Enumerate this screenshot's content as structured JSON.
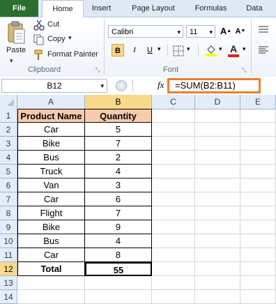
{
  "tabs": [
    "File",
    "Home",
    "Insert",
    "Page Layout",
    "Formulas",
    "Data"
  ],
  "clipboard": {
    "paste": "Paste",
    "cut": "Cut",
    "copy": "Copy",
    "format_painter": "Format Painter",
    "group_label": "Clipboard"
  },
  "font": {
    "name": "Calibri",
    "size": "11",
    "group_label": "Font",
    "bold": "B",
    "italic": "I",
    "underline": "U"
  },
  "formula_bar": {
    "name_box": "B12",
    "fx": "fx",
    "formula": "=SUM(B2:B11)"
  },
  "columns": [
    "A",
    "B",
    "C",
    "D",
    "E"
  ],
  "rows": [
    "1",
    "2",
    "3",
    "4",
    "5",
    "6",
    "7",
    "8",
    "9",
    "10",
    "11",
    "12",
    "13",
    "14"
  ],
  "table": {
    "headers": [
      "Product Name",
      "Quantity"
    ],
    "data": [
      [
        "Car",
        "5"
      ],
      [
        "Bike",
        "7"
      ],
      [
        "Bus",
        "2"
      ],
      [
        "Truck",
        "4"
      ],
      [
        "Van",
        "3"
      ],
      [
        "Car",
        "6"
      ],
      [
        "Flight",
        "7"
      ],
      [
        "Bike",
        "9"
      ],
      [
        "Bus",
        "4"
      ],
      [
        "Car",
        "8"
      ]
    ],
    "total_label": "Total",
    "total_value": "55"
  },
  "colors": {
    "header_fill": "#f8cbad",
    "file_tab": "#2a6f2f",
    "highlight": "#ee7d2e",
    "header_bg": "#e4ecf7",
    "selected_header": "#f9d98b"
  }
}
